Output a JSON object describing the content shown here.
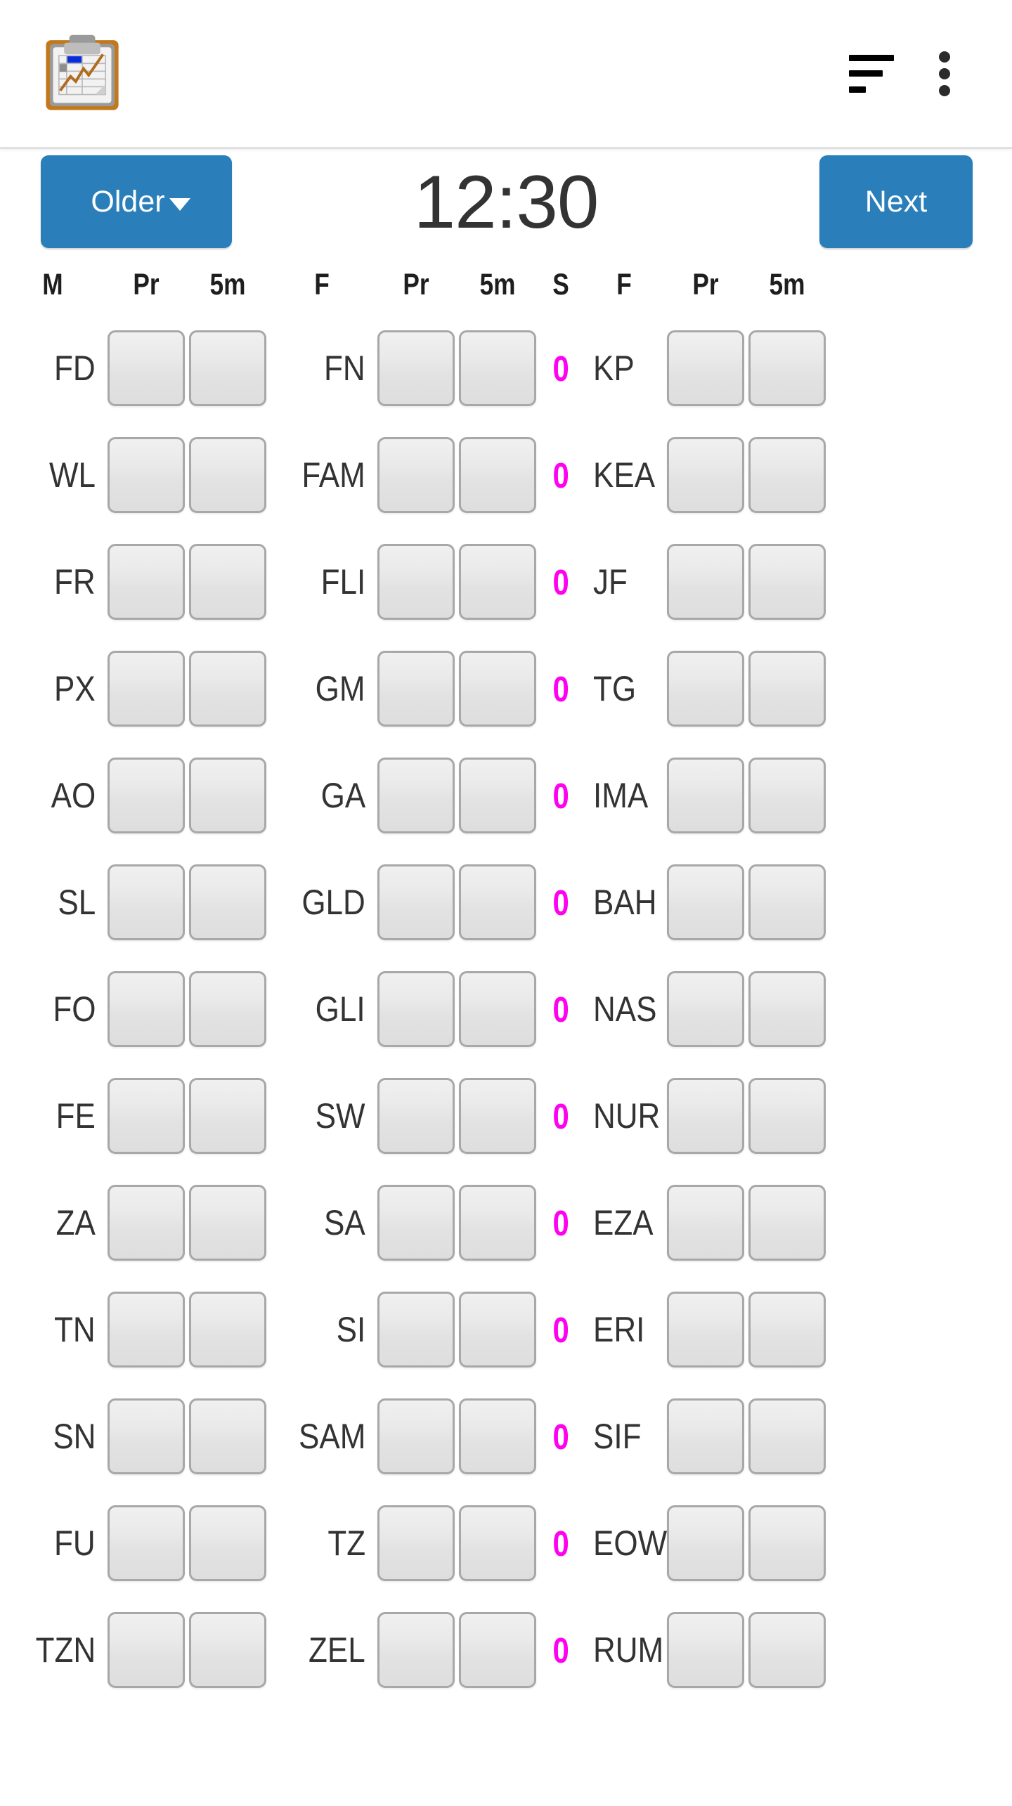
{
  "appbar": {
    "logo_icon": "clipboard-chart-icon",
    "sort_icon": "sort-lines-icon",
    "overflow_icon": "more-vertical-icon"
  },
  "toolbar": {
    "older_label": "Older",
    "older_caret_icon": "caret-down-icon",
    "time": "12:30",
    "next_label": "Next"
  },
  "colors": {
    "accent": "#2a7fba",
    "zero": "#ff00f0",
    "text": "#333333",
    "cell_border": "#a8a8a8"
  },
  "grid": {
    "headers": [
      "M",
      "Pr",
      "5m",
      "F",
      "Pr",
      "5m",
      "S",
      "F",
      "Pr",
      "5m"
    ],
    "rows": [
      {
        "m": "FD",
        "f1": "FN",
        "s": "0",
        "f2": "KP"
      },
      {
        "m": "WL",
        "f1": "FAM",
        "s": "0",
        "f2": "KEA"
      },
      {
        "m": "FR",
        "f1": "FLI",
        "s": "0",
        "f2": "JF"
      },
      {
        "m": "PX",
        "f1": "GM",
        "s": "0",
        "f2": "TG"
      },
      {
        "m": "AO",
        "f1": "GA",
        "s": "0",
        "f2": "IMA"
      },
      {
        "m": "SL",
        "f1": "GLD",
        "s": "0",
        "f2": "BAH"
      },
      {
        "m": "FO",
        "f1": "GLI",
        "s": "0",
        "f2": "NAS"
      },
      {
        "m": "FE",
        "f1": "SW",
        "s": "0",
        "f2": "NUR"
      },
      {
        "m": "ZA",
        "f1": "SA",
        "s": "0",
        "f2": "EZA"
      },
      {
        "m": "TN",
        "f1": "SI",
        "s": "0",
        "f2": "ERI"
      },
      {
        "m": "SN",
        "f1": "SAM",
        "s": "0",
        "f2": "SIF"
      },
      {
        "m": "FU",
        "f1": "TZ",
        "s": "0",
        "f2": "EOW"
      },
      {
        "m": "TZN",
        "f1": "ZEL",
        "s": "0",
        "f2": "RUM"
      }
    ]
  }
}
